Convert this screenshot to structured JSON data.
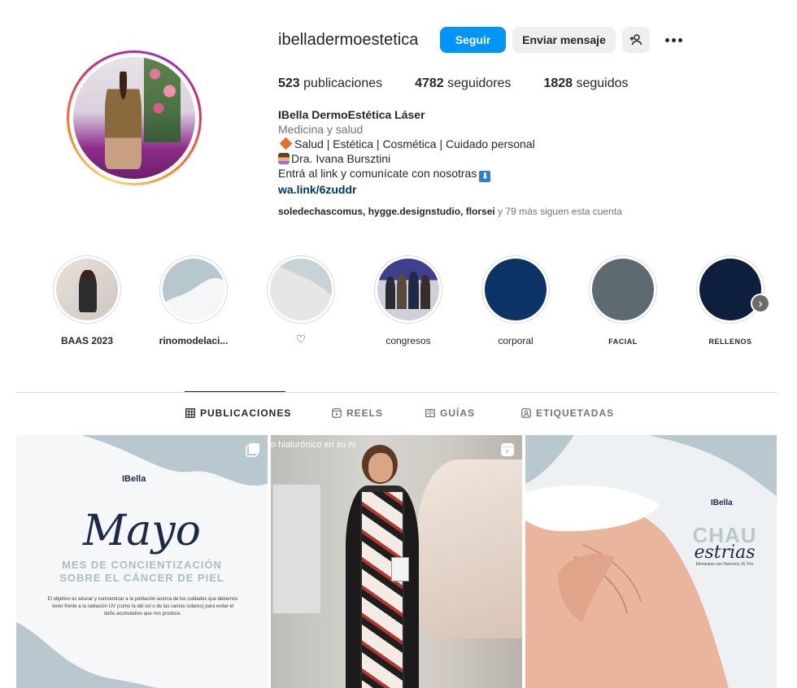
{
  "profile": {
    "username": "ibelladermoestetica",
    "follow_label": "Seguir",
    "message_label": "Enviar mensaje",
    "add_user_icon": "add-user-icon",
    "more_icon": "more-options-icon"
  },
  "stats": {
    "posts_count": "523",
    "posts_label": "publicaciones",
    "followers_count": "4782",
    "followers_label": "seguidores",
    "following_count": "1828",
    "following_label": "seguidos"
  },
  "bio": {
    "name": "IBella DermoEstética Láser",
    "category": "Medicina y salud",
    "line1": "Salud | Estética | Cosmética | Cuidado personal",
    "line2": "Dra. Ivana Bursztini",
    "line3": "Entrá al link y comunícate con nosotras",
    "link": "wa.link/6zuddr",
    "followed_by_names": "soledechascomus, hygge.designstudio, florsei",
    "followed_by_suffix": " y 79 más siguen esta cuenta"
  },
  "highlights": [
    {
      "label": "BAAS 2023",
      "kind": "photo"
    },
    {
      "label": "rinomodelaci...",
      "kind": "blob-blue"
    },
    {
      "label": "♡",
      "kind": "blob-grey"
    },
    {
      "label": "congresos",
      "kind": "photo2"
    },
    {
      "label": "corporal",
      "color": "#0b3366"
    },
    {
      "label": "FACIAL",
      "color": "#5d6a6f"
    },
    {
      "label": "RELLENOS",
      "color": "#0e1f3d"
    }
  ],
  "tabs": [
    {
      "label": "PUBLICACIONES",
      "icon": "grid-icon",
      "active": true
    },
    {
      "label": "REELS",
      "icon": "reels-icon",
      "active": false
    },
    {
      "label": "GUÍAS",
      "icon": "guides-icon",
      "active": false
    },
    {
      "label": "ETIQUETADAS",
      "icon": "tagged-icon",
      "active": false
    }
  ],
  "posts": {
    "p1": {
      "brand": "IBella",
      "title": "Mayo",
      "subtitle_line1": "MES DE CONCIENTIZACIÓN",
      "subtitle_line2": "SOBRE EL CÁNCER DE PIEL",
      "body": "El objetivo es educar y concientizar a la población acerca de los cuidados que debemos tener frente a la radiación UV (como la del sol o de las camas solares) para evitar el daño acumulativo que nos produce."
    },
    "p2": {
      "overlay": "o hialurónico en su m"
    },
    "p3": {
      "brand": "IBella",
      "title": "CHAU",
      "title2": "estrias",
      "sub": "Eliminalas con Harmony XL Pro"
    }
  },
  "colors": {
    "accent": "#0095f6",
    "link": "#00376b"
  }
}
